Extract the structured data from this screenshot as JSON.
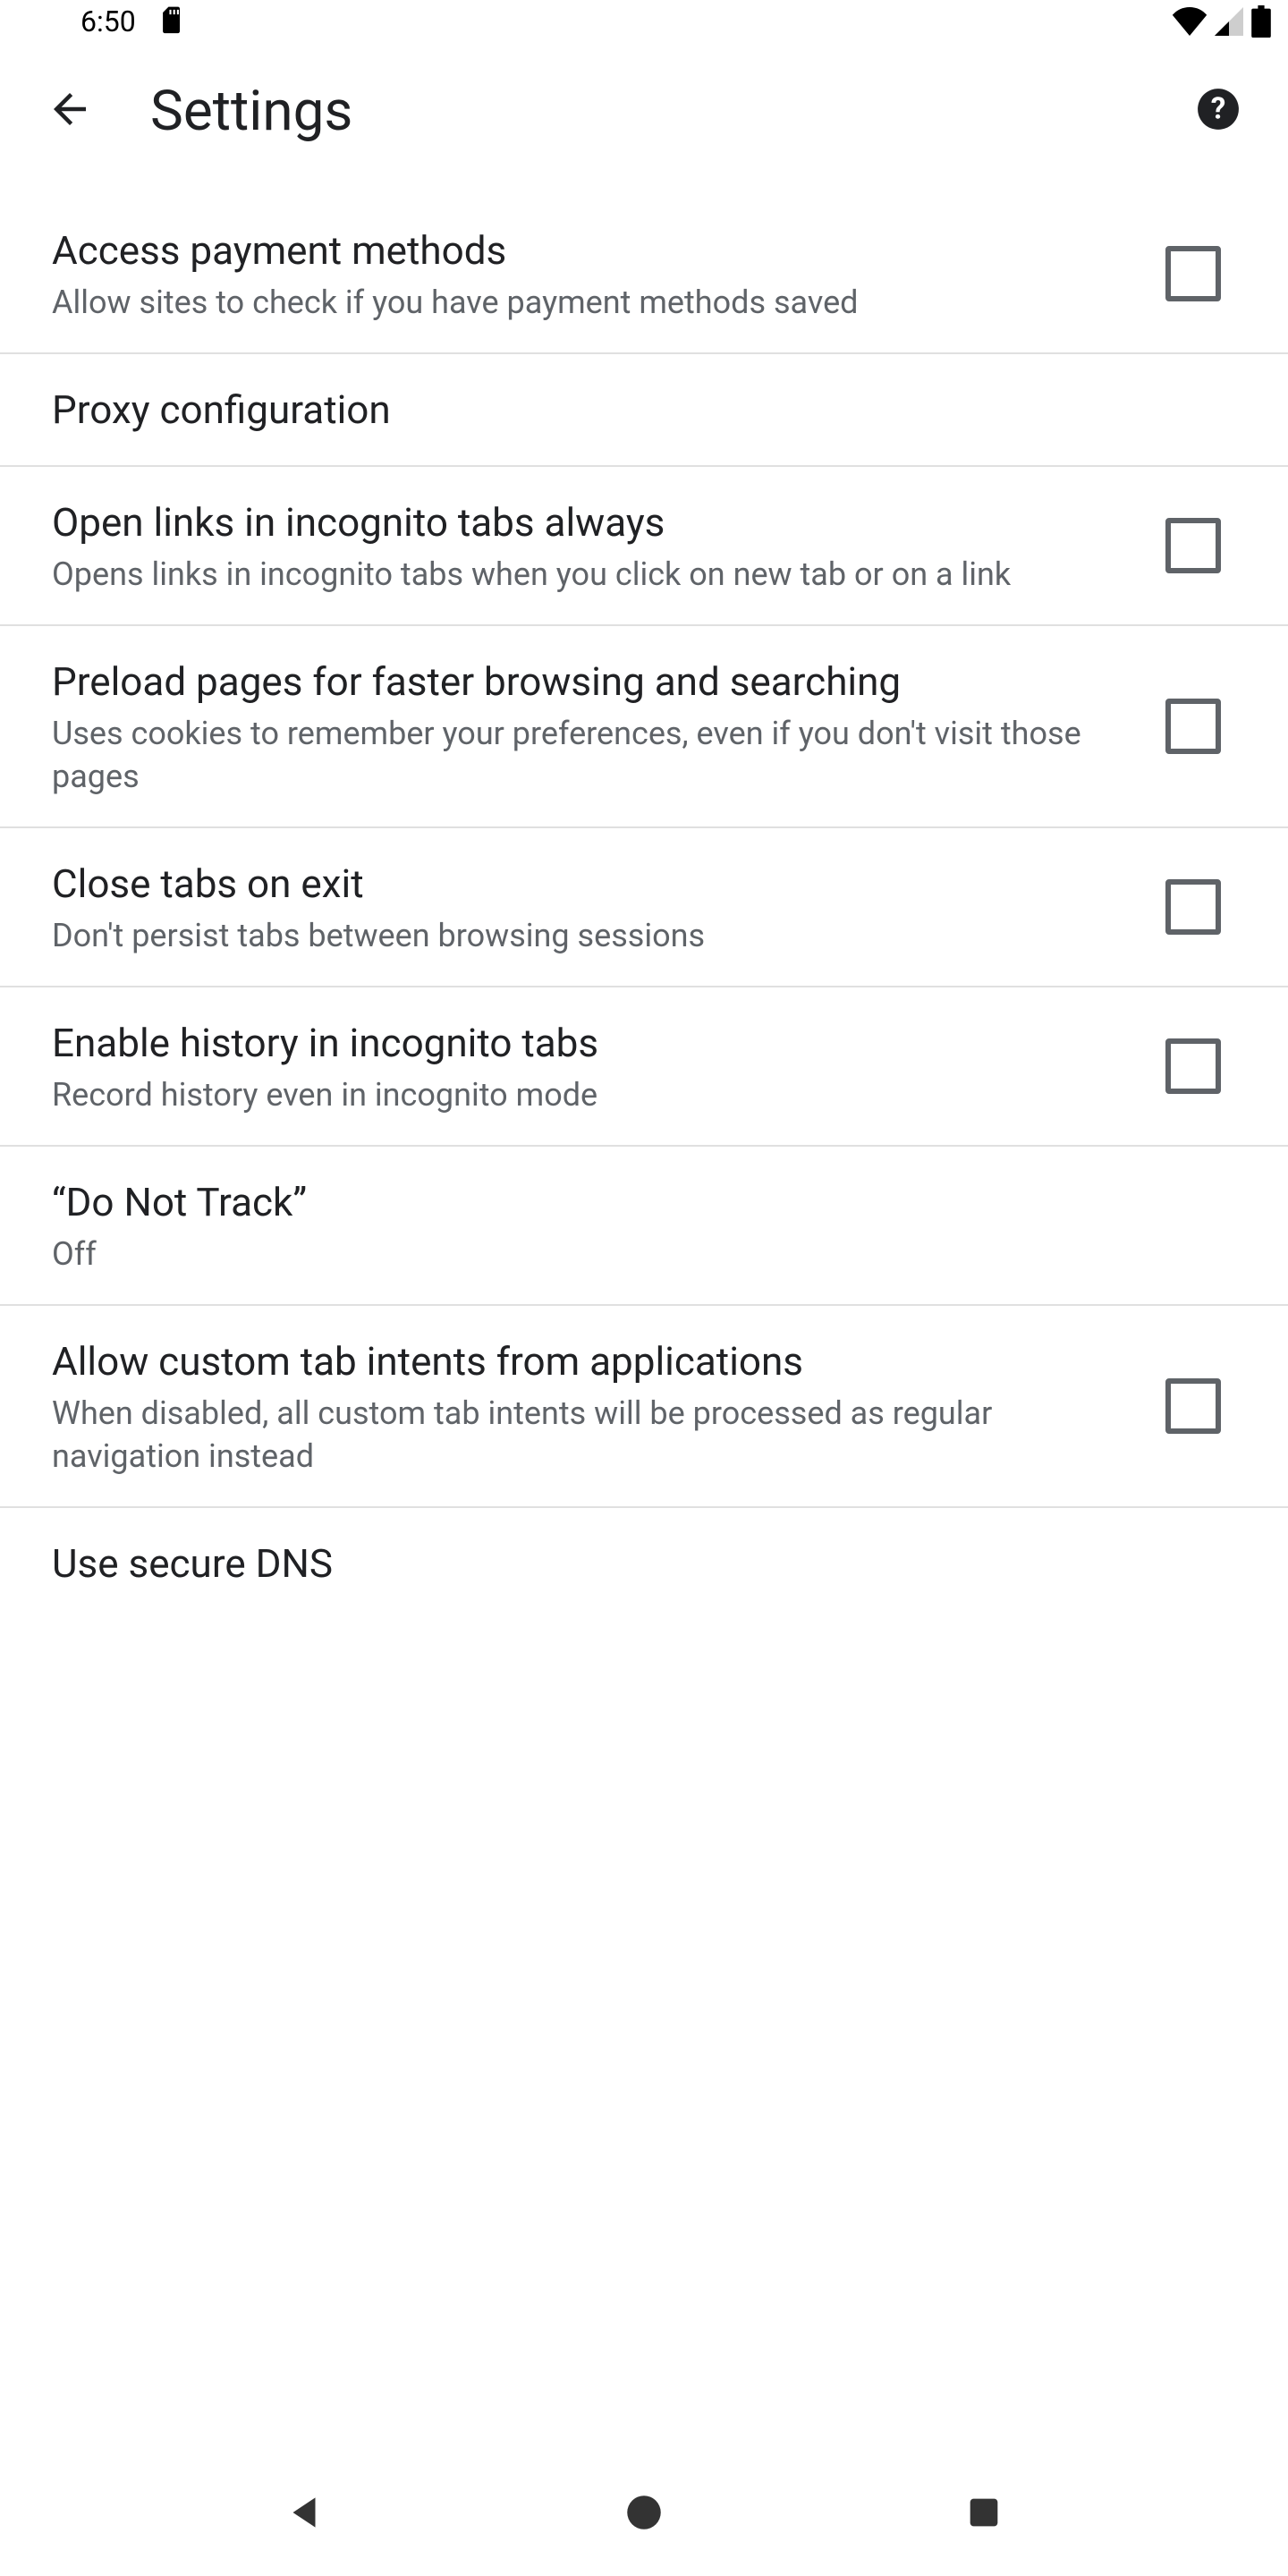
{
  "statusbar": {
    "time": "6:50"
  },
  "appbar": {
    "title": "Settings"
  },
  "rows": [
    {
      "title": "Access payment methods",
      "sub": "Allow sites to check if you have payment methods saved",
      "check": true
    },
    {
      "title": "Proxy configuration",
      "sub": "",
      "check": false
    },
    {
      "title": "Open links in incognito tabs always",
      "sub": "Opens links in incognito tabs when you click on new tab or on a link",
      "check": true
    },
    {
      "title": "Preload pages for faster browsing and searching",
      "sub": "Uses cookies to remember your preferences, even if you don't visit those pages",
      "check": true
    },
    {
      "title": "Close tabs on exit",
      "sub": "Don't persist tabs between browsing sessions",
      "check": true
    },
    {
      "title": "Enable history in incognito tabs",
      "sub": "Record history even in incognito mode",
      "check": true
    },
    {
      "title": "“Do Not Track”",
      "sub": "Off",
      "check": false
    },
    {
      "title": "Allow custom tab intents from applications",
      "sub": "When disabled, all custom tab intents will be processed as regular navigation instead",
      "check": true
    },
    {
      "title": "Use secure DNS",
      "sub": "",
      "check": false
    }
  ]
}
